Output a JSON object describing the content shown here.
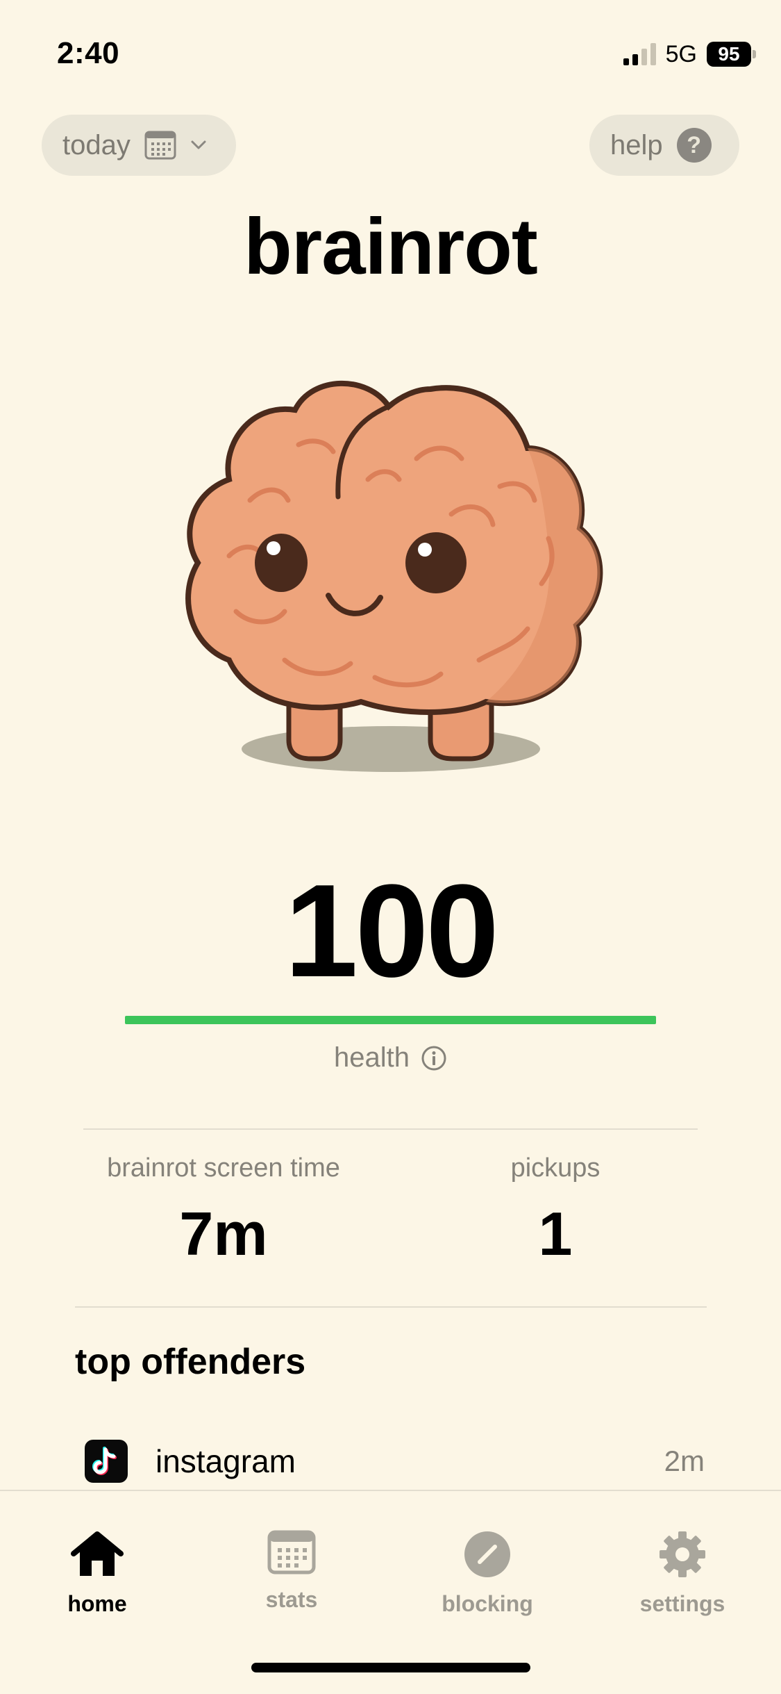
{
  "status_bar": {
    "time": "2:40",
    "network": "5G",
    "battery": "95"
  },
  "header": {
    "date_picker_label": "today",
    "help_label": "help",
    "help_icon_glyph": "?",
    "title": "brainrot"
  },
  "mascot": {
    "icon": "brain-mascot",
    "colors": {
      "brain": "#eea47c",
      "outline": "#4a2a1c",
      "shadow": "#b5b19f"
    }
  },
  "health": {
    "score": "100",
    "label": "health",
    "fill_fraction": 1.0,
    "bar_color": "#3cc45a"
  },
  "stats": {
    "screen_time_label": "brainrot screen time",
    "screen_time_value": "7m",
    "pickups_label": "pickups",
    "pickups_value": "1"
  },
  "top_offenders": {
    "title": "top offenders",
    "items": [
      {
        "name": "instagram",
        "time": "2m",
        "icon": "tiktok-app-icon"
      }
    ]
  },
  "tab_bar": {
    "tabs": [
      {
        "label": "home",
        "icon": "home-icon",
        "active": true
      },
      {
        "label": "stats",
        "icon": "calendar-icon",
        "active": false
      },
      {
        "label": "blocking",
        "icon": "blocking-icon",
        "active": false
      },
      {
        "label": "settings",
        "icon": "gear-icon",
        "active": false
      }
    ]
  },
  "colors": {
    "background": "#fcf6e6",
    "pill": "#eae6d8",
    "secondary_text": "#85827a"
  }
}
